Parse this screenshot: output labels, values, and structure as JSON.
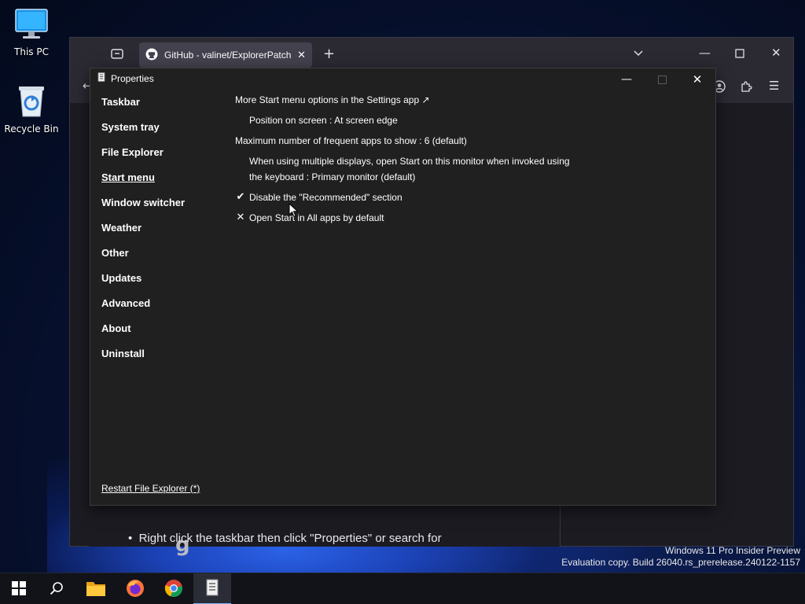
{
  "desktop": {
    "icons": [
      {
        "label": "This PC",
        "icon": "computer-icon"
      },
      {
        "label": "Recycle Bin",
        "icon": "recycle-bin-icon"
      }
    ],
    "watermark_line1": "Windows 11 Pro Insider Preview",
    "watermark_line2": "Evaluation copy. Build 26040.rs_prerelease.240122-1157"
  },
  "browser": {
    "tab_title": "GitHub - valinet/ExplorerPatcher",
    "tab_icon": "github-icon",
    "new_tab": "+",
    "page_bullet": "Right click the taskbar then click \"Properties\" or search for",
    "page_heading_fragment": "g"
  },
  "properties": {
    "title": "Properties",
    "sidebar": [
      {
        "label": "Taskbar"
      },
      {
        "label": "System tray"
      },
      {
        "label": "File Explorer"
      },
      {
        "label": "Start menu",
        "active": true
      },
      {
        "label": "Window switcher"
      },
      {
        "label": "Weather"
      },
      {
        "label": "Other"
      },
      {
        "label": "Updates"
      },
      {
        "label": "Advanced"
      },
      {
        "label": "About"
      },
      {
        "label": "Uninstall"
      }
    ],
    "restart_link": "Restart File Explorer (*)",
    "options": {
      "more_start_link": "More Start menu options in the Settings app ↗",
      "position": "Position on screen : At screen edge",
      "max_frequent": "Maximum number of frequent apps to show : 6 (default)",
      "multi_display_line1": "When using multiple displays, open Start on this monitor when invoked using",
      "multi_display_line2": "the keyboard : Primary monitor (default)",
      "disable_recommended": "Disable the \"Recommended\" section",
      "disable_recommended_mark": "✔",
      "all_apps_default": "Open Start in All apps by default",
      "all_apps_mark": "✕"
    }
  },
  "taskbar": {
    "items": [
      "start-icon",
      "search-icon",
      "file-explorer-icon",
      "firefox-icon",
      "chrome-icon",
      "properties-app-icon"
    ]
  }
}
